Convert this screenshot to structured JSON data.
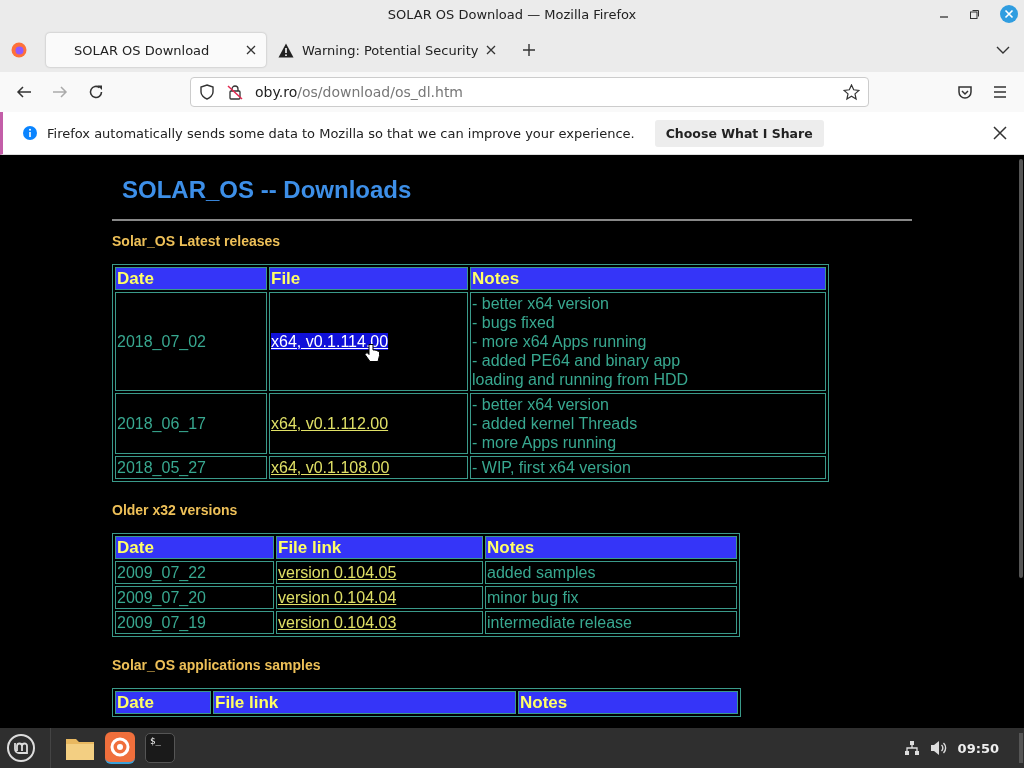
{
  "window": {
    "title": "SOLAR OS Download — Mozilla Firefox"
  },
  "tabs": [
    {
      "label": "SOLAR OS Download",
      "selected": true,
      "kind": "page"
    },
    {
      "label": "Warning: Potential Security",
      "selected": false,
      "kind": "warning"
    }
  ],
  "address_bar": {
    "host": "oby.ro",
    "path": "/os/download/os_dl.htm"
  },
  "notification": {
    "text": "Firefox automatically sends some data to Mozilla so that we can improve your experience.",
    "button": "Choose What I Share"
  },
  "page": {
    "heading": "SOLAR_OS -- Downloads",
    "sections": [
      {
        "title": "Solar_OS Latest releases",
        "columns": [
          "Date",
          "File",
          "Notes"
        ],
        "rows": [
          {
            "date": "2018_07_02",
            "file": "x64, v0.1.114.00",
            "selected": true,
            "notes": [
              "- better x64 version",
              "- bugs fixed",
              "- more x64 Apps running",
              "- added PE64 and binary app",
              "loading and running from HDD"
            ]
          },
          {
            "date": "2018_06_17",
            "file": "x64, v0.1.112.00",
            "selected": false,
            "notes": [
              "- better x64 version",
              "- added kernel Threads",
              "- more Apps running"
            ]
          },
          {
            "date": "2018_05_27",
            "file": "x64, v0.1.108.00",
            "selected": false,
            "notes": [
              "- WIP, first x64 version"
            ]
          }
        ]
      },
      {
        "title": "Older x32 versions",
        "columns": [
          "Date",
          "File link",
          "Notes"
        ],
        "rows": [
          {
            "date": "2009_07_22",
            "file": "version 0.104.05",
            "selected": false,
            "notes": [
              "added samples"
            ]
          },
          {
            "date": "2009_07_20",
            "file": "version 0.104.04",
            "selected": false,
            "notes": [
              "minor bug fix"
            ]
          },
          {
            "date": "2009_07_19",
            "file": "version 0.104.03",
            "selected": false,
            "notes": [
              "intermediate release"
            ]
          }
        ]
      },
      {
        "title": "Solar_OS applications samples",
        "columns": [
          "Date",
          "File link",
          "Notes"
        ]
      }
    ]
  },
  "taskbar": {
    "terminal_label": "$_",
    "clock": "09:50"
  }
}
